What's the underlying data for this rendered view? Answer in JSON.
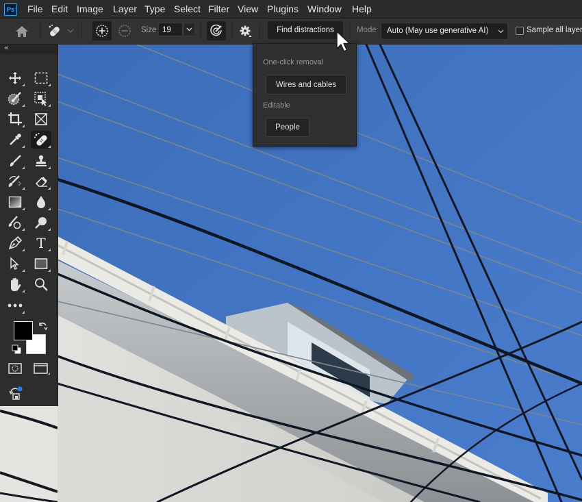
{
  "app": {
    "logo_text": "Ps"
  },
  "menubar": {
    "items": [
      "File",
      "Edit",
      "Image",
      "Layer",
      "Type",
      "Select",
      "Filter",
      "View",
      "Plugins",
      "Window",
      "Help"
    ]
  },
  "options_bar": {
    "home_icon": "home-icon",
    "tool_icon": "remove-tool-icon",
    "add_mode_icon": "brush-add-icon",
    "subtract_mode_icon": "brush-subtract-icon",
    "size_label": "Size",
    "size_value": "19",
    "pressure_icon": "pressure-icon",
    "settings_icon": "gear-icon",
    "find_distractions_label": "Find distractions",
    "mode_label": "Mode",
    "mode_value": "Auto (May use generative AI)",
    "sample_all_layers_label": "Sample all layers",
    "sample_all_layers_checked": false
  },
  "distractions_popup": {
    "section1_label": "One-click removal",
    "wires_button": "Wires and cables",
    "section2_label": "Editable",
    "people_button": "People"
  },
  "toolbox": {
    "collapse_icon": "«",
    "tools": [
      {
        "name": "move-tool",
        "icon": "move-icon"
      },
      {
        "name": "marquee-tool",
        "icon": "rect-marquee-icon"
      },
      {
        "name": "quick-selection-tool",
        "icon": "quick-select-icon"
      },
      {
        "name": "object-selection-tool",
        "icon": "object-select-icon"
      },
      {
        "name": "crop-tool",
        "icon": "crop-icon"
      },
      {
        "name": "frame-tool",
        "icon": "frame-icon"
      },
      {
        "name": "eyedropper-tool",
        "icon": "eyedropper-icon"
      },
      {
        "name": "remove-tool",
        "icon": "bandage-icon",
        "active": true
      },
      {
        "name": "brush-tool",
        "icon": "brush-icon"
      },
      {
        "name": "clone-stamp-tool",
        "icon": "stamp-icon"
      },
      {
        "name": "history-brush-tool",
        "icon": "history-brush-icon"
      },
      {
        "name": "eraser-tool",
        "icon": "eraser-icon"
      },
      {
        "name": "gradient-tool",
        "icon": "gradient-icon"
      },
      {
        "name": "blur-tool",
        "icon": "drop-icon"
      },
      {
        "name": "dodge-tool",
        "icon": "dodge-icon"
      },
      {
        "name": "dodge2-tool",
        "icon": "magnify-dodge-icon"
      },
      {
        "name": "pen-tool",
        "icon": "pen-icon"
      },
      {
        "name": "type-tool",
        "icon": "type-icon"
      },
      {
        "name": "path-selection-tool",
        "icon": "arrow-icon"
      },
      {
        "name": "rectangle-tool",
        "icon": "rectangle-icon"
      },
      {
        "name": "hand-tool",
        "icon": "hand-icon"
      },
      {
        "name": "zoom-tool",
        "icon": "zoom-icon"
      },
      {
        "name": "edit-toolbar",
        "icon": "more-icon"
      }
    ],
    "type_glyph": "T",
    "foreground_color": "#000000",
    "background_color": "#ffffff"
  },
  "colors": {
    "sky": "#3d6fb8",
    "ui_dark": "#2b2b2b",
    "ps_blue": "#31a8ff"
  }
}
